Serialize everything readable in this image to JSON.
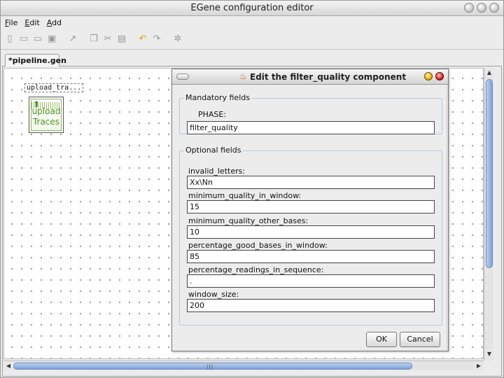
{
  "window": {
    "title": "EGene configuration editor"
  },
  "menubar": {
    "items": [
      "File",
      "Edit",
      "Add"
    ]
  },
  "toolbar": {
    "icons": [
      "new-file-icon",
      "open-folder-icon",
      "open-recent-icon",
      "save-icon",
      "connect-arrow-icon",
      "copy-icon",
      "cut-icon",
      "paste-icon",
      "undo-icon",
      "redo-icon",
      "settings-icon"
    ]
  },
  "tab": {
    "label": "*pipeline.gen"
  },
  "canvas": {
    "node": {
      "label": "upload_tra...",
      "caption_line1": "upload",
      "caption_line2": "Traces"
    }
  },
  "dialog": {
    "title": "Edit the filter_quality component",
    "mandatory": {
      "legend": "Mandatory fields",
      "fields": [
        {
          "label": "PHASE:",
          "value": "filter_quality"
        }
      ]
    },
    "optional": {
      "legend": "Optional fields",
      "fields": [
        {
          "label": "invalid_letters:",
          "value": "Xx\\Nn"
        },
        {
          "label": "minimum_quality_in_window:",
          "value": "15"
        },
        {
          "label": "minimum_quality_other_bases:",
          "value": "10"
        },
        {
          "label": "percentage_good_bases_in_window:",
          "value": "85"
        },
        {
          "label": "percentage_readings_in_sequence:",
          "value": "."
        },
        {
          "label": "window_size:",
          "value": "200"
        }
      ]
    },
    "ok_label": "OK",
    "cancel_label": "Cancel"
  }
}
